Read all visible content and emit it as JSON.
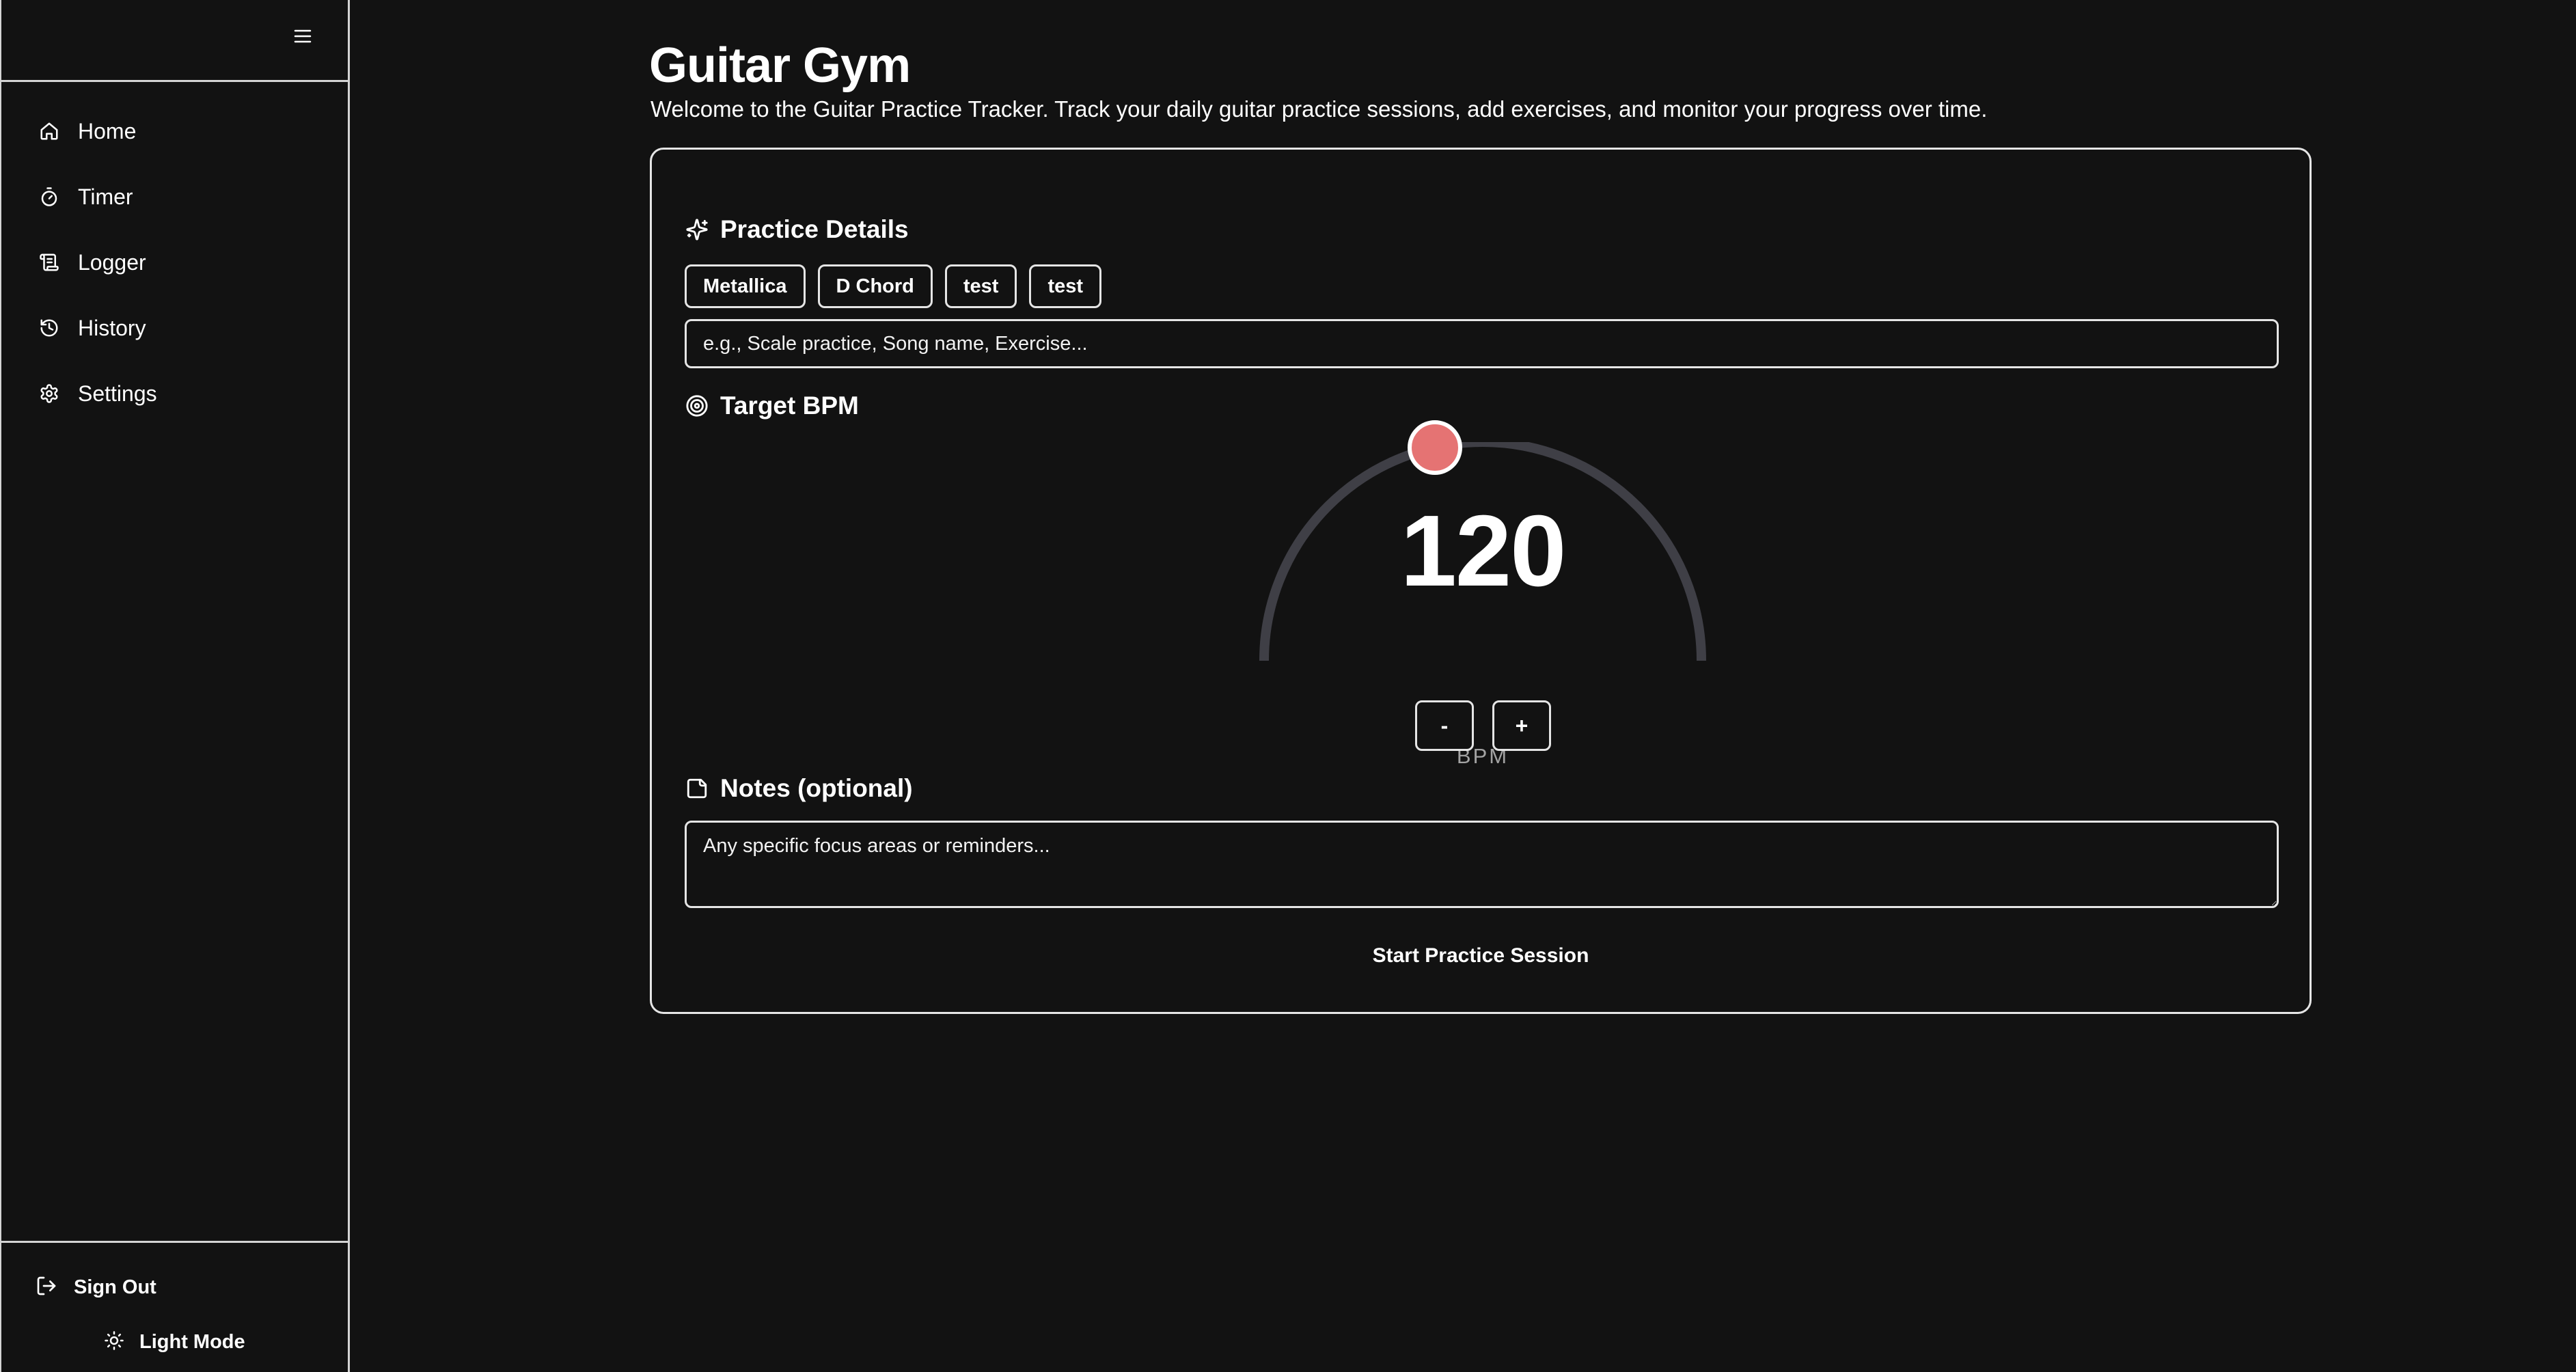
{
  "sidebar": {
    "items": [
      {
        "label": "Home",
        "icon": "home-icon"
      },
      {
        "label": "Timer",
        "icon": "timer-icon"
      },
      {
        "label": "Logger",
        "icon": "logger-icon"
      },
      {
        "label": "History",
        "icon": "history-icon"
      },
      {
        "label": "Settings",
        "icon": "gear-icon"
      }
    ],
    "footer": {
      "sign_out": "Sign Out",
      "theme_toggle": "Light Mode"
    }
  },
  "main": {
    "title": "Guitar Gym",
    "subtitle": "Welcome to the Guitar Practice Tracker. Track your daily guitar practice sessions, add exercises, and monitor your progress over time."
  },
  "card": {
    "practice_details": {
      "heading": "Practice Details",
      "tags": [
        "Metallica",
        "D Chord",
        "test",
        "test"
      ],
      "input_placeholder": "e.g., Scale practice, Song name, Exercise..."
    },
    "target_bpm": {
      "heading": "Target BPM",
      "value": "120",
      "unit": "BPM",
      "decrement_label": "-",
      "increment_label": "+",
      "dial_fraction": 0.43
    },
    "notes": {
      "heading": "Notes (optional)",
      "placeholder": "Any specific focus areas or reminders..."
    },
    "start_label": "Start Practice Session"
  },
  "colors": {
    "background": "#121212",
    "border": "#e5e5e5",
    "dial_track": "#3f3f46",
    "dial_knob": "#e57373",
    "muted_text": "#a3a3a3"
  }
}
